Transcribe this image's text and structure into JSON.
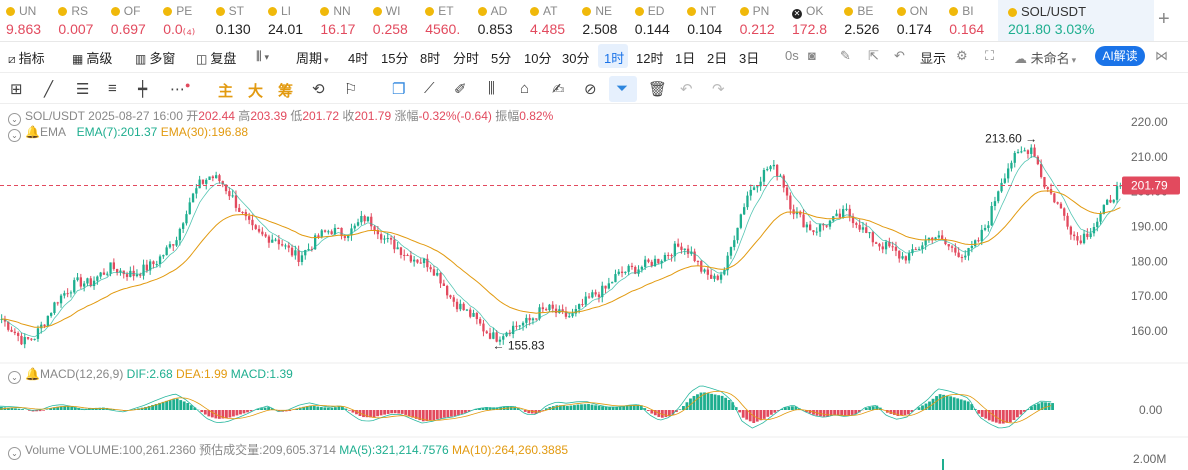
{
  "ticker": [
    {
      "symbol": "UN",
      "price": "9.863",
      "dir": "up",
      "icon": "coin-icon"
    },
    {
      "symbol": "RS",
      "price": "0.007",
      "dir": "up",
      "icon": "coin-icon"
    },
    {
      "symbol": "OF",
      "price": "0.697",
      "dir": "up",
      "icon": "coin-icon"
    },
    {
      "symbol": "PE",
      "price": "0.0₍₄₎",
      "dir": "up",
      "icon": "coin-icon"
    },
    {
      "symbol": "ST",
      "price": "0.130",
      "dir": "dn",
      "icon": "coin-icon"
    },
    {
      "symbol": "LI",
      "price": "24.01",
      "dir": "dn",
      "icon": "coin-icon"
    },
    {
      "symbol": "NN",
      "price": "16.17",
      "dir": "up",
      "icon": "coin-icon"
    },
    {
      "symbol": "WI",
      "price": "0.258",
      "dir": "up",
      "icon": "coin-icon"
    },
    {
      "symbol": "ET",
      "price": "4560.",
      "dir": "up",
      "icon": "coin-icon"
    },
    {
      "symbol": "AD",
      "price": "0.853",
      "dir": "dn",
      "icon": "coin-icon"
    },
    {
      "symbol": "AT",
      "price": "4.485",
      "dir": "up",
      "icon": "coin-icon"
    },
    {
      "symbol": "NE",
      "price": "2.508",
      "dir": "dn",
      "icon": "coin-icon"
    },
    {
      "symbol": "ED",
      "price": "0.144",
      "dir": "dn",
      "icon": "coin-icon"
    },
    {
      "symbol": "NT",
      "price": "0.104",
      "dir": "dn",
      "icon": "coin-icon"
    },
    {
      "symbol": "PN",
      "price": "0.212",
      "dir": "up",
      "icon": "coin-icon"
    },
    {
      "symbol": "OK",
      "price": "172.8",
      "dir": "up",
      "icon": "okx-icon"
    },
    {
      "symbol": "BE",
      "price": "2.526",
      "dir": "dn",
      "icon": "coin-icon"
    },
    {
      "symbol": "ON",
      "price": "0.174",
      "dir": "dn",
      "icon": "coin-icon"
    },
    {
      "symbol": "BI",
      "price": "0.164",
      "dir": "up",
      "icon": "coin-icon"
    }
  ],
  "active_ticker": {
    "symbol": "SOL/USDT",
    "price": "201.80",
    "change": "3.03%"
  },
  "add_tab_label": "+",
  "toolbar": {
    "indicators": "指标",
    "advanced": "高级",
    "multi_window": "多窗",
    "replay": "复盘",
    "chart_type_icon": "candles-icon",
    "period": "周期",
    "timeframes": [
      "4时",
      "15分",
      "8时",
      "分时",
      "5分",
      "10分",
      "30分",
      "1时",
      "12时",
      "1日",
      "2日",
      "3日"
    ],
    "active_timeframe": "1时",
    "countdown": "0s",
    "display": "显示",
    "layout_name": "未命名",
    "ai_button": "AI解读"
  },
  "drawing_tools": {
    "text_tools": [
      "主",
      "大",
      "筹"
    ]
  },
  "chart": {
    "header": {
      "pair": "SOL/USDT",
      "datetime": "2025-08-27 16:00",
      "open_label": "开",
      "open": "202.44",
      "high_label": "高",
      "high": "203.39",
      "low_label": "低",
      "low": "201.72",
      "close_label": "收",
      "close": "201.79",
      "change_label": "涨幅",
      "change": "-0.32%(-0.64)",
      "amp_label": "振幅",
      "amp": "0.82%"
    },
    "ema": {
      "name": "EMA",
      "ema7": "EMA(7):201.37",
      "ema30": "EMA(30):196.88"
    },
    "macd": {
      "name": "MACD(12,26,9)",
      "dif": "DIF:2.68",
      "dea": "DEA:1.99",
      "macd": "MACD:1.39"
    },
    "volume": {
      "label": "Volume",
      "volume": "VOLUME:100,261.2360",
      "est": "预估成交量:209,605.3714",
      "ma5": "MA(5):321,214.7576",
      "ma10": "MA(10):264,260.3885"
    },
    "colors": {
      "up": "#1eae8f",
      "down": "#e24a5e",
      "ema30": "#e29a10",
      "accent": "#1a73e8"
    }
  },
  "chart_data": {
    "type": "candlestick",
    "title": "SOL/USDT",
    "price_axis": {
      "ticks": [
        "220.00",
        "210.00",
        "200.00",
        "190.00",
        "180.00",
        "170.00",
        "160.00"
      ],
      "ylim": [
        153.7,
        224.9
      ]
    },
    "last_price_label": "201.79",
    "high_marker": "213.60 →",
    "low_marker": "← 155.83",
    "high_value": 213.6,
    "low_value": 155.83,
    "close_series": [
      163.5,
      160.3,
      156.9,
      158.4,
      163.2,
      168.7,
      171.8,
      174.1,
      173.6,
      176.2,
      178.3,
      177.0,
      176.2,
      177.8,
      179.6,
      183.0,
      187.2,
      196.4,
      201.9,
      204.5,
      203.0,
      198.5,
      193.1,
      188.4,
      187.0,
      186.7,
      183.6,
      181.2,
      183.8,
      187.4,
      189.1,
      188.0,
      188.9,
      192.6,
      190.5,
      186.0,
      184.3,
      181.8,
      180.4,
      179.3,
      175.1,
      169.3,
      166.5,
      163.9,
      160.4,
      158.0,
      160.1,
      161.8,
      162.6,
      165.5,
      166.3,
      164.5,
      164.2,
      167.6,
      170.5,
      171.8,
      175.7,
      177.4,
      178.0,
      179.4,
      180.7,
      182.9,
      184.8,
      182.0,
      176.5,
      174.8,
      178.1,
      189.8,
      199.2,
      203.5,
      207.4,
      205.0,
      195.6,
      191.6,
      188.9,
      190.5,
      192.0,
      194.2,
      191.2,
      187.2,
      184.9,
      183.9,
      181.1,
      181.9,
      185.3,
      187.6,
      185.0,
      182.8,
      181.9,
      185.6,
      191.9,
      202.3,
      208.6,
      211.3,
      213.0,
      202.5,
      197.8,
      192.5,
      185.9,
      188.3,
      192.0,
      197.6,
      201.79
    ],
    "volume_axis": {
      "ticks": [
        "2.00M"
      ]
    },
    "macd_axis": {
      "ticks": [
        "0.00"
      ]
    },
    "macd_hist": [
      0.6,
      0.4,
      0.2,
      -0.3,
      -0.2,
      0.5,
      0.8,
      0.6,
      0.2,
      0.4,
      0.5,
      0.1,
      -0.2,
      0.2,
      0.6,
      1.2,
      1.8,
      2.3,
      1.5,
      0.2,
      -1.2,
      -1.8,
      -1.6,
      -1.0,
      -0.4,
      0.3,
      0.6,
      -0.4,
      -0.2,
      0.5,
      0.9,
      0.6,
      0.4,
      0.8,
      -0.4,
      -1.4,
      -1.5,
      -1.0,
      -0.6,
      -0.8,
      -1.6,
      -2.3,
      -2.0,
      -1.5,
      -1.2,
      -0.6,
      0.2,
      0.6,
      0.5,
      0.8,
      0.7,
      -0.6,
      -0.8,
      0.5,
      1.0,
      0.8,
      1.1,
      1.2,
      0.8,
      0.6,
      0.7,
      1.0,
      1.1,
      -0.6,
      -1.6,
      -1.2,
      0.4,
      2.6,
      3.6,
      3.2,
      2.8,
      1.5,
      -1.6,
      -2.6,
      -1.8,
      -0.6,
      0.5,
      0.8,
      -0.3,
      -1.1,
      -1.4,
      -1.0,
      -1.2,
      -0.8,
      0.5,
      0.9,
      -0.6,
      -1.2,
      -0.9,
      0.5,
      1.6,
      3.2,
      2.8,
      2.2,
      1.6,
      -1.2,
      -2.2,
      -2.8,
      -2.4,
      -0.8,
      0.8,
      1.6,
      1.39
    ]
  }
}
